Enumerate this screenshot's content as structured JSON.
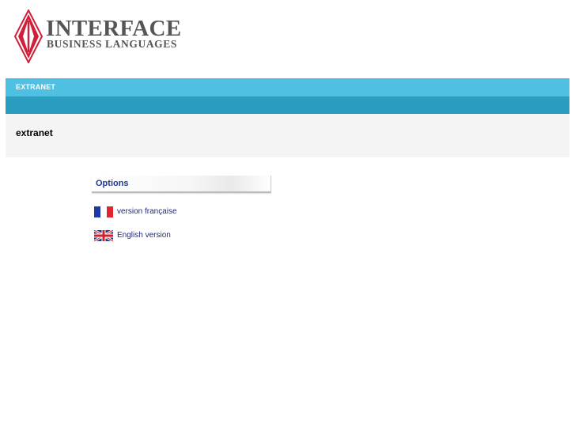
{
  "brand": {
    "logo_title": "INTERFACE",
    "logo_subtitle": "BUSINESS LANGUAGES",
    "mark_color": "#d01f3a"
  },
  "header": {
    "section_label": "EXTRANET",
    "top_bar_color": "#4fc0e2",
    "bottom_bar_color": "#2a9cbf"
  },
  "page": {
    "title": "extranet"
  },
  "options": {
    "heading": "Options",
    "languages": [
      {
        "icon": "flag-france-icon",
        "label": "version française"
      },
      {
        "icon": "flag-uk-icon",
        "label": "English version"
      }
    ]
  }
}
